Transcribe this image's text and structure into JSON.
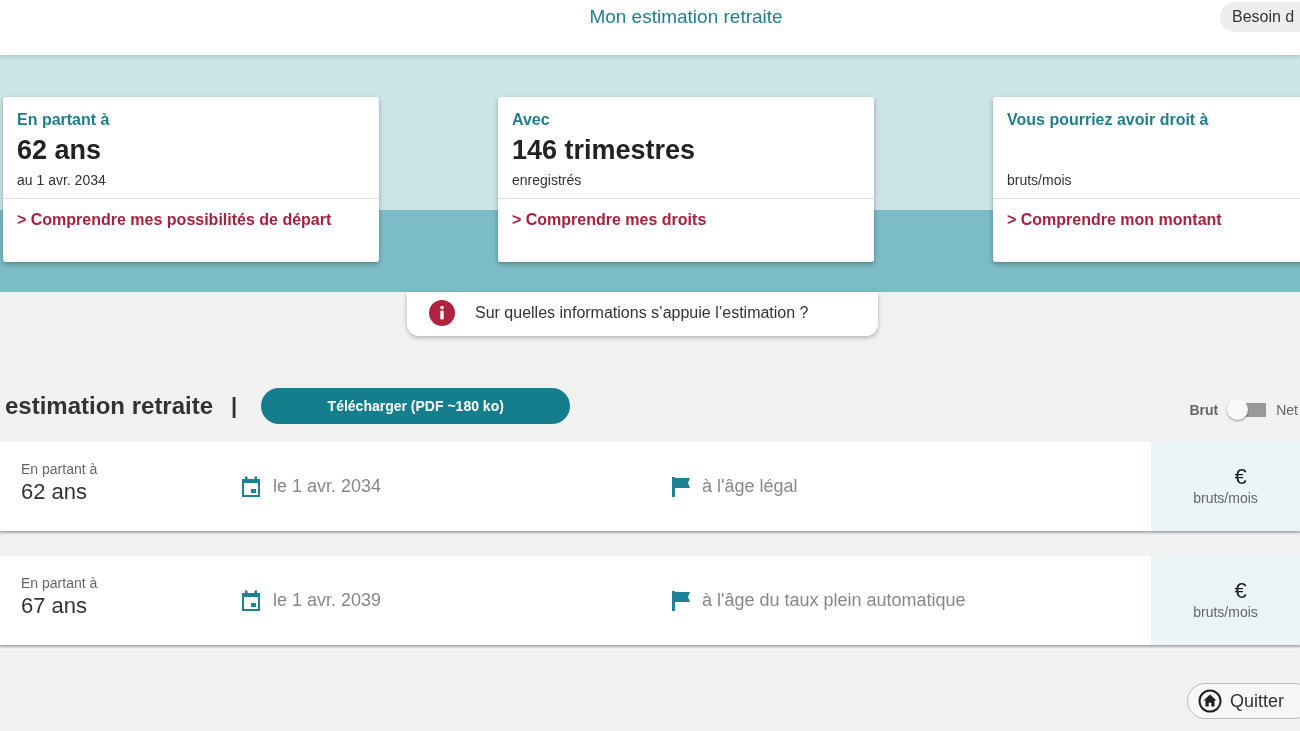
{
  "header": {
    "title": "Mon estimation retraite",
    "help_button": "Besoin d"
  },
  "summary_cards": [
    {
      "label": "En partant à",
      "value": "62 ans",
      "detail": "au 1 avr. 2034",
      "link": "> Comprendre mes possibilités de départ"
    },
    {
      "label": "Avec",
      "value": "146 trimestres",
      "detail": "enregistrés",
      "link": "> Comprendre mes droits"
    },
    {
      "label": "Vous pourriez avoir droit à",
      "detail": "bruts/mois",
      "link": "> Comprendre mon montant"
    }
  ],
  "info_button": "Sur quelles informations s’appuie l’estimation ?",
  "section": {
    "title": "estimation retraite",
    "separator": "|",
    "download_button": "Télécharger (PDF ~180 ko)"
  },
  "toggle": {
    "left_label": "Brut",
    "right_label": "Net",
    "on": false
  },
  "estimates": [
    {
      "label": "En partant à",
      "age": "62 ans",
      "date": "le 1 avr. 2034",
      "condition": "à l'âge légal",
      "currency": "€",
      "unit": "bruts/mois"
    },
    {
      "label": "En partant à",
      "age": "67 ans",
      "date": "le 1 avr. 2039",
      "condition": "à l'âge du taux plein automatique",
      "currency": "€",
      "unit": "bruts/mois"
    }
  ],
  "quit_button": "Quitter"
}
